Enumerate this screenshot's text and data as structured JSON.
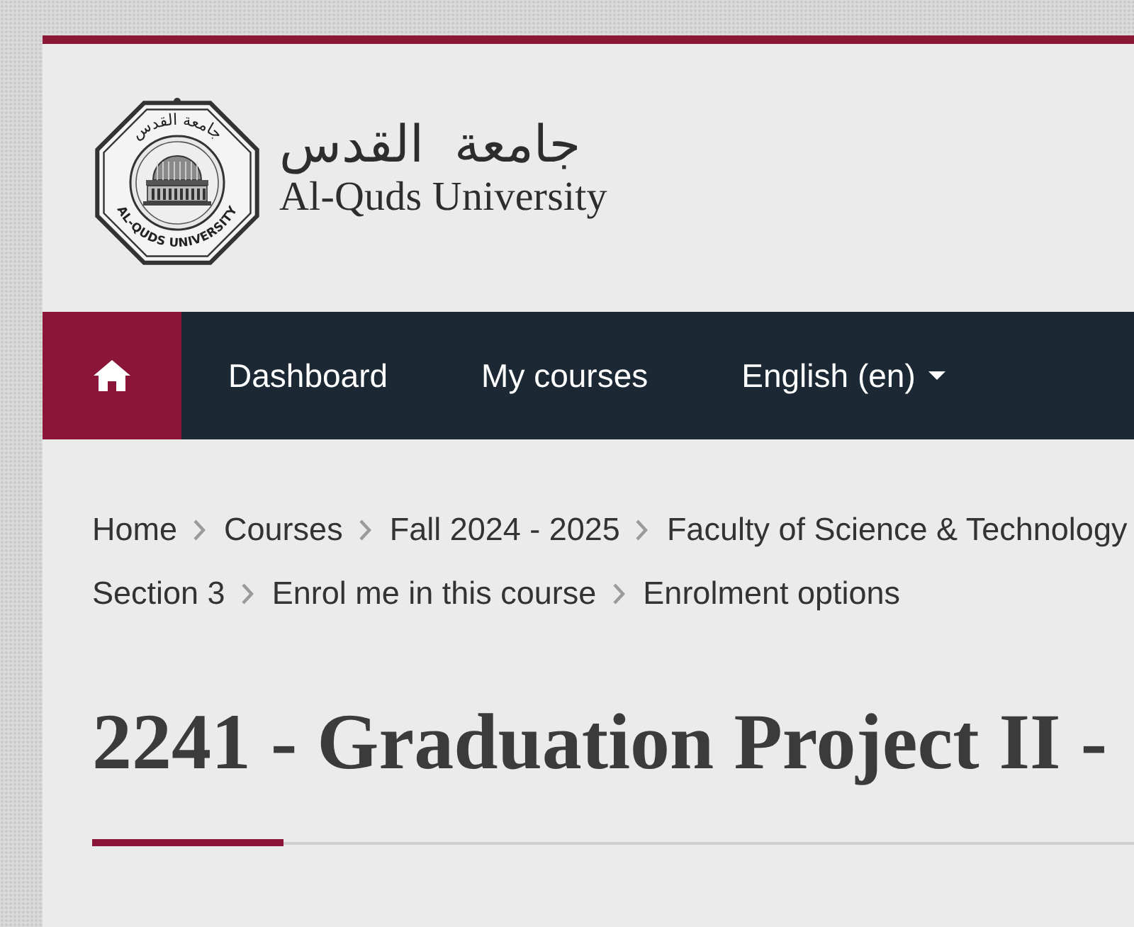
{
  "header": {
    "logo": {
      "seal_top_text": "جامعة القدس",
      "seal_bottom_text": "AL-QUDS UNIVERSITY",
      "name_ar": "جامعة القدس",
      "name_en": "Al-Quds University"
    }
  },
  "navbar": {
    "items": [
      {
        "kind": "home"
      },
      {
        "kind": "link",
        "label": "Dashboard"
      },
      {
        "kind": "link",
        "label": "My courses"
      },
      {
        "kind": "dropdown",
        "label": "English (en)"
      }
    ]
  },
  "breadcrumb": {
    "lines": [
      {
        "items": [
          "Home",
          "Courses",
          "Fall 2024 - 2025",
          "Faculty of Science & Technology"
        ]
      },
      {
        "items": [
          "Section 3",
          "Enrol me in this course",
          "Enrolment options"
        ]
      }
    ]
  },
  "page_header": {
    "title": "2241 - Graduation Project II -"
  }
}
